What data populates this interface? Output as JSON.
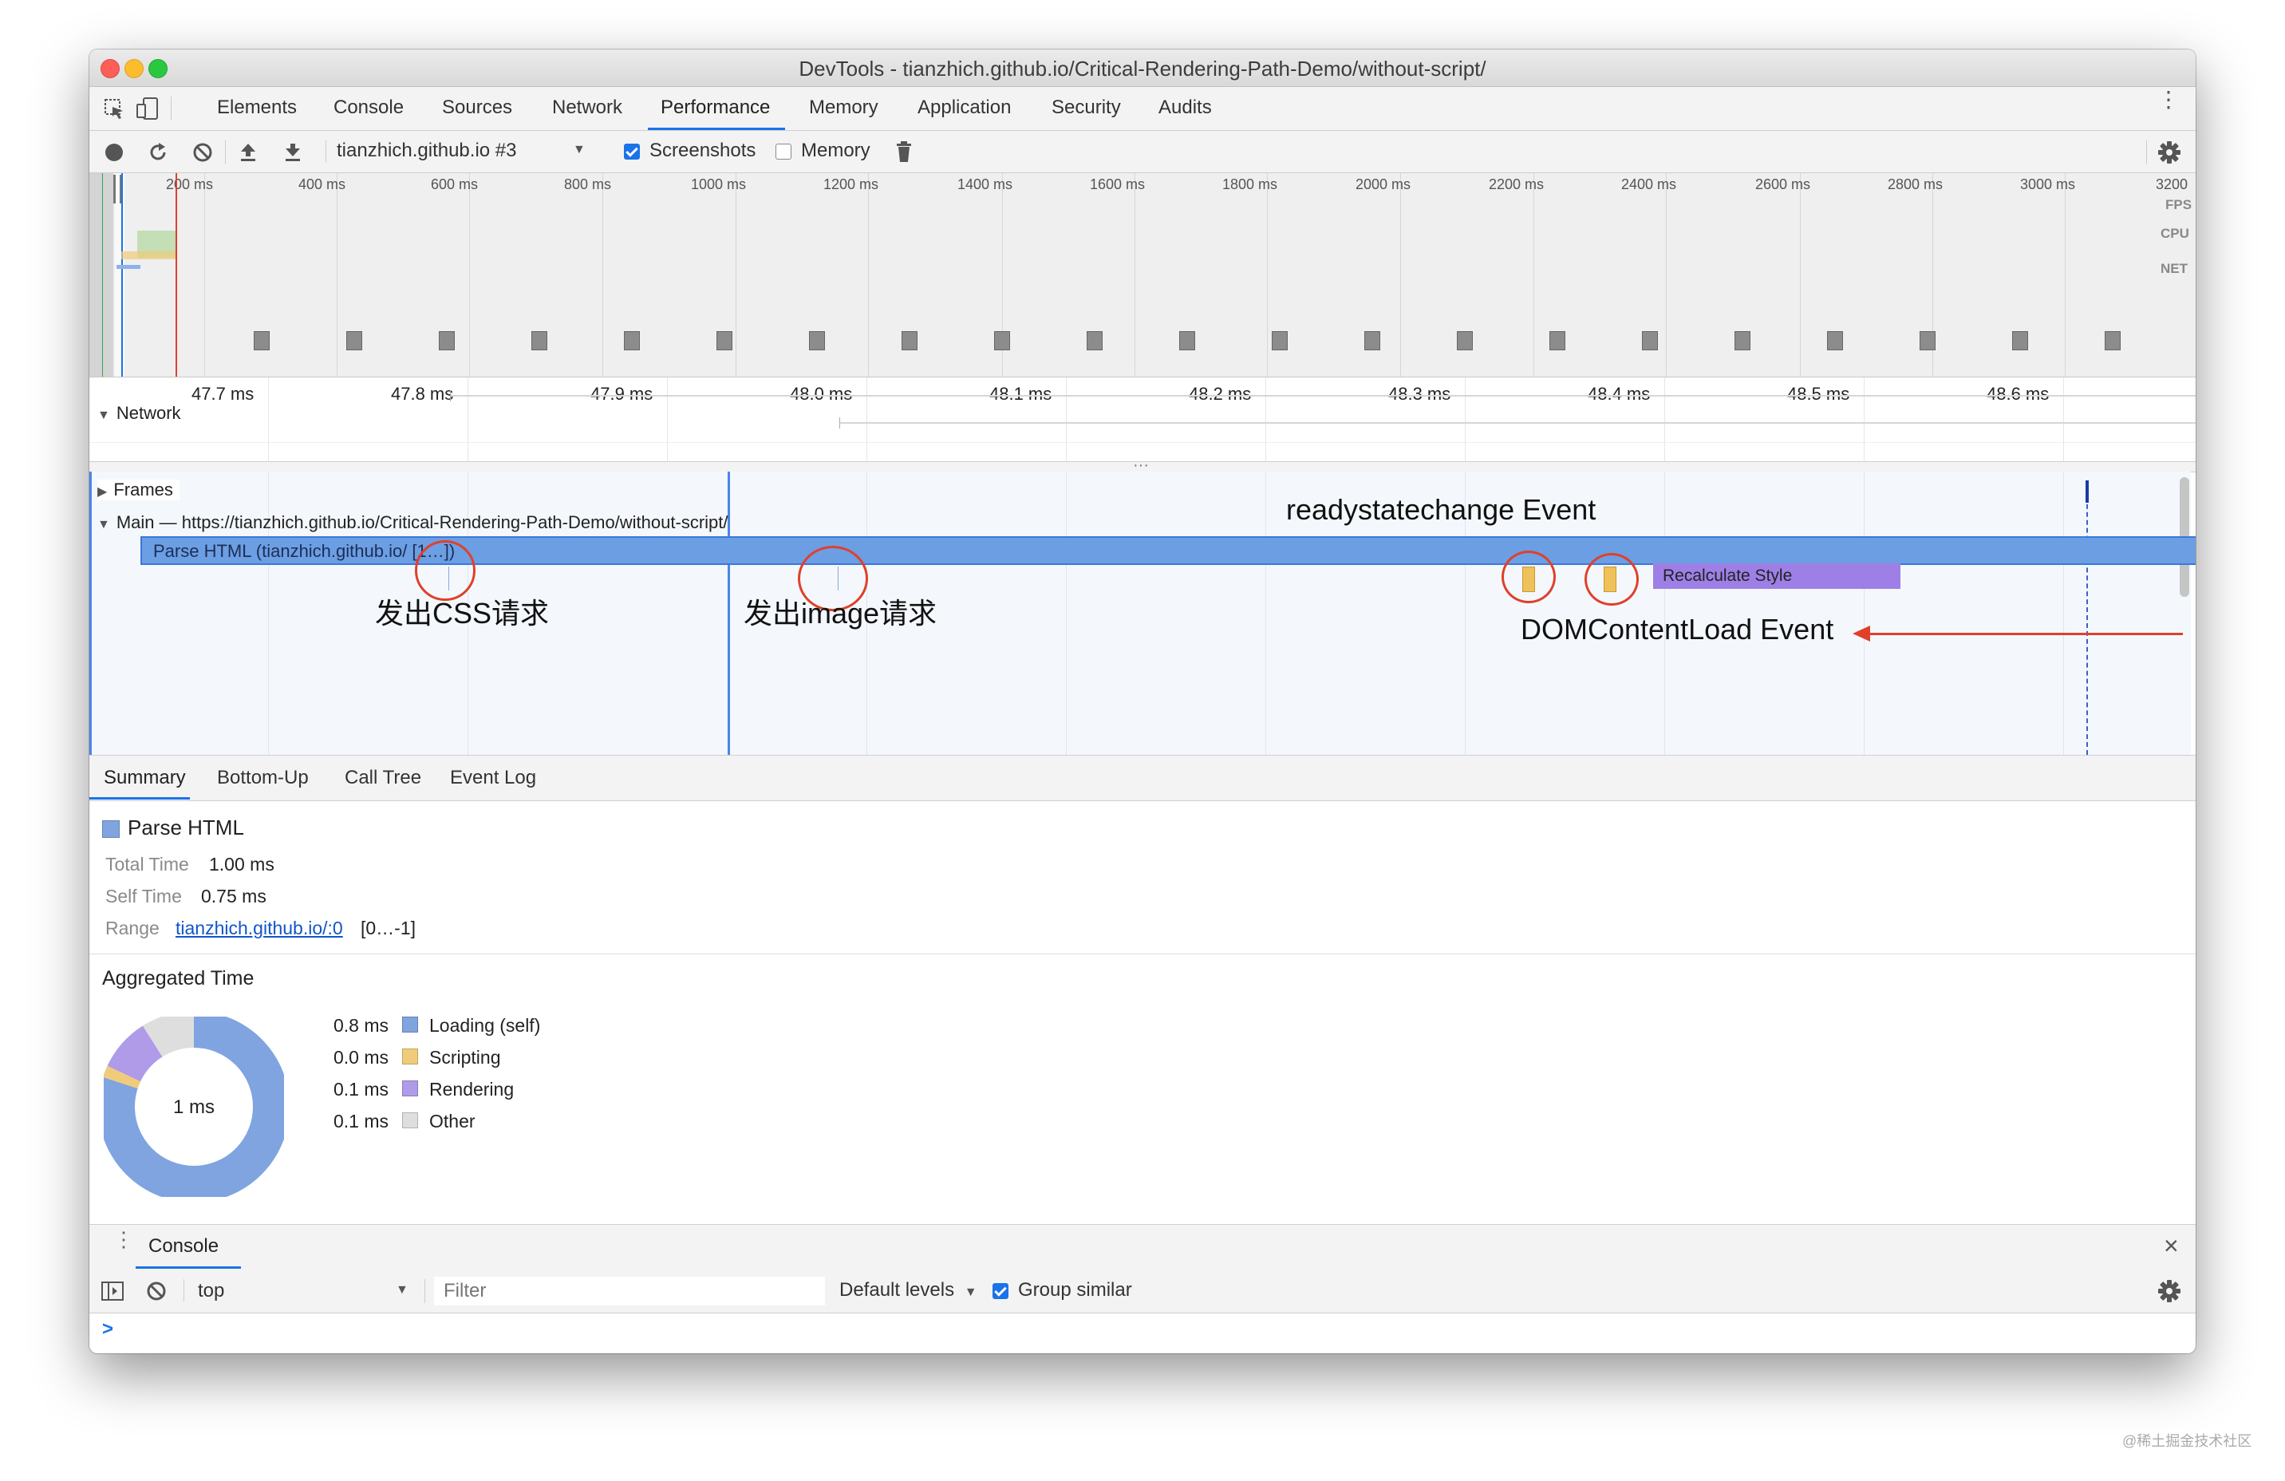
{
  "window": {
    "title": "DevTools - tianzhich.github.io/Critical-Rendering-Path-Demo/without-script/"
  },
  "tabs": [
    "Elements",
    "Console",
    "Sources",
    "Network",
    "Performance",
    "Memory",
    "Application",
    "Security",
    "Audits"
  ],
  "active_tab": "Performance",
  "toolbar": {
    "profile_select": "tianzhich.github.io #3",
    "screenshots_label": "Screenshots",
    "screenshots_checked": true,
    "memory_label": "Memory",
    "memory_checked": false
  },
  "overview": {
    "ticks": [
      "200 ms",
      "400 ms",
      "600 ms",
      "800 ms",
      "1000 ms",
      "1200 ms",
      "1400 ms",
      "1600 ms",
      "1800 ms",
      "2000 ms",
      "2200 ms",
      "2400 ms",
      "2600 ms",
      "2800 ms",
      "3000 ms",
      "3200"
    ],
    "labels": {
      "fps": "FPS",
      "cpu": "CPU",
      "net": "NET"
    }
  },
  "ruler": {
    "ticks": [
      "47.7 ms",
      "47.8 ms",
      "47.9 ms",
      "48.0 ms",
      "48.1 ms",
      "48.2 ms",
      "48.3 ms",
      "48.4 ms",
      "48.5 ms",
      "48.6 ms"
    ]
  },
  "tracks": {
    "network": "Network",
    "frames": "Frames",
    "main": "Main — https://tianzhich.github.io/Critical-Rendering-Path-Demo/without-script/",
    "parse_html": "Parse HTML (tianzhich.github.io/ [1…])",
    "recalculate_style": "Recalculate Style"
  },
  "annotations": {
    "css_request": "发出CSS请求",
    "image_request": "发出image请求",
    "readystatechange": "readystatechange Event",
    "dom_content_loaded": "DOMContentLoad Event"
  },
  "bottom_tabs": [
    "Summary",
    "Bottom-Up",
    "Call Tree",
    "Event Log"
  ],
  "active_bottom_tab": "Summary",
  "summary": {
    "title": "Parse HTML",
    "title_color": "#7fa4e0",
    "total_time_label": "Total Time",
    "total_time_value": "1.00 ms",
    "self_time_label": "Self Time",
    "self_time_value": "0.75 ms",
    "range_label": "Range",
    "range_link": "tianzhich.github.io/:0",
    "range_extra": "[0…-1]",
    "aggregated_title": "Aggregated Time",
    "donut_center": "1 ms",
    "legend": [
      {
        "value": "0.8 ms",
        "label": "Loading (self)",
        "color": "#7fa4e0",
        "fraction": 0.8
      },
      {
        "value": "0.0 ms",
        "label": "Scripting",
        "color": "#f0cc7a",
        "fraction": 0.02
      },
      {
        "value": "0.1 ms",
        "label": "Rendering",
        "color": "#b09be8",
        "fraction": 0.09
      },
      {
        "value": "0.1 ms",
        "label": "Other",
        "color": "#dedede",
        "fraction": 0.09
      }
    ]
  },
  "console": {
    "tab_label": "Console",
    "context": "top",
    "filter_placeholder": "Filter",
    "levels": "Default levels",
    "group_similar_label": "Group similar",
    "group_similar_checked": true,
    "prompt": ">"
  },
  "watermark": "@稀土掘金技术社区"
}
